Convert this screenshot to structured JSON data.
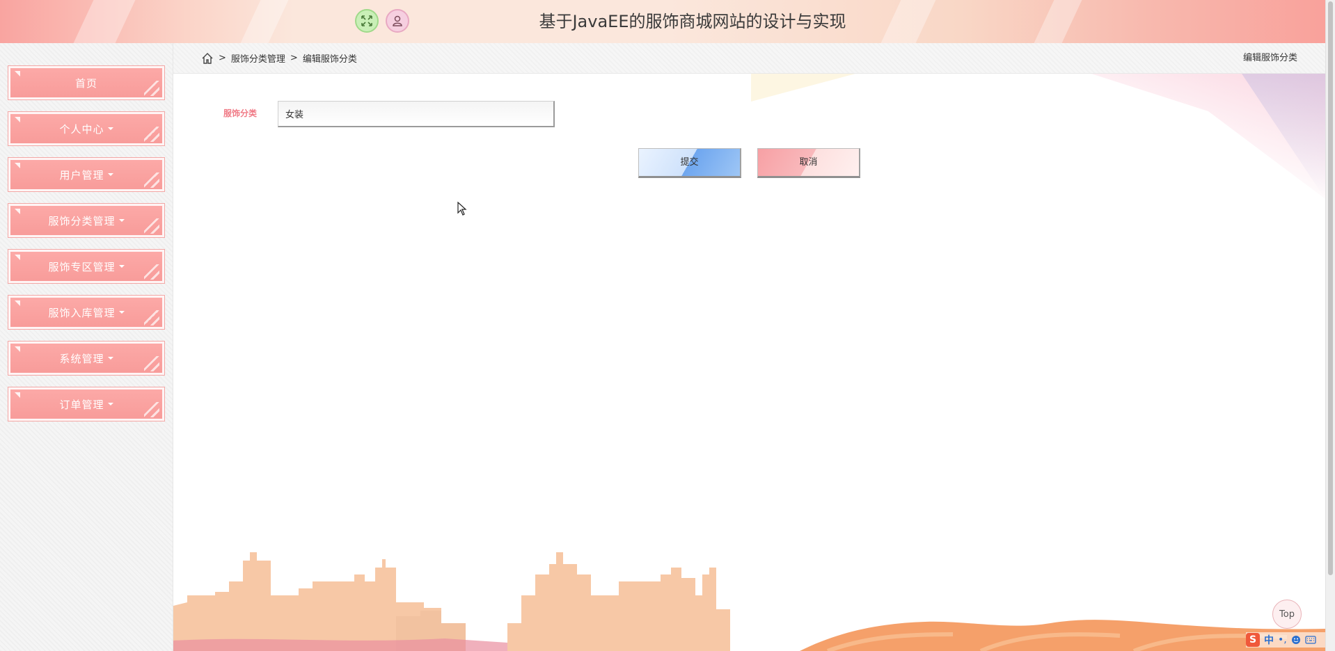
{
  "header": {
    "title": "基于JavaEE的服饰商城网站的设计与实现",
    "fullscreen_icon": "expand-arrows-icon",
    "user_icon": "user-icon"
  },
  "sidebar": {
    "items": [
      {
        "label": "首页",
        "has_submenu": false
      },
      {
        "label": "个人中心",
        "has_submenu": true
      },
      {
        "label": "用户管理",
        "has_submenu": true
      },
      {
        "label": "服饰分类管理",
        "has_submenu": true
      },
      {
        "label": "服饰专区管理",
        "has_submenu": true
      },
      {
        "label": "服饰入库管理",
        "has_submenu": true
      },
      {
        "label": "系统管理",
        "has_submenu": true
      },
      {
        "label": "订单管理",
        "has_submenu": true
      }
    ]
  },
  "breadcrumb": {
    "home_icon": "home-icon",
    "sep": ">",
    "items": [
      "服饰分类管理",
      "编辑服饰分类"
    ],
    "right_title": "编辑服饰分类"
  },
  "form": {
    "category_label": "服饰分类",
    "category_value": "女装",
    "submit_label": "提交",
    "cancel_label": "取消"
  },
  "top_button": {
    "label": "Top"
  },
  "ime": {
    "brand": "S",
    "lang": "中",
    "punct": "•,"
  },
  "colors": {
    "menu_bg": "#f89c9a",
    "label_pink": "#f07a86",
    "header_accent": "#f9a4a0"
  }
}
